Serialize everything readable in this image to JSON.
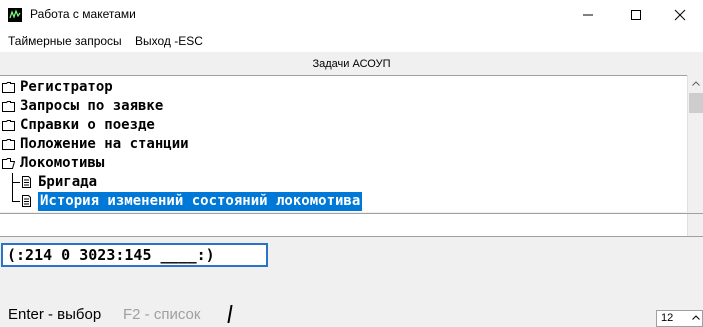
{
  "window": {
    "title": "Работа с макетами"
  },
  "menu": {
    "items": [
      {
        "label": "Таймерные запросы"
      },
      {
        "label": "Выход -ESC"
      }
    ]
  },
  "panel": {
    "header": "Задачи АСОУП"
  },
  "tree": {
    "items": [
      {
        "label": "Регистратор",
        "icon": "folder-icon"
      },
      {
        "label": "Запросы по заявке",
        "icon": "folder-icon"
      },
      {
        "label": "Справки о поезде",
        "icon": "folder-icon"
      },
      {
        "label": "Положение на станции",
        "icon": "folder-icon"
      },
      {
        "label": "Локомотивы",
        "icon": "folder-open-icon"
      },
      {
        "label": "Бригада",
        "icon": "document-icon"
      },
      {
        "label": "История изменений состояний локомотива",
        "icon": "document-icon",
        "selected": true
      }
    ]
  },
  "command": {
    "value": "(:214 0 3023:145 ____:)"
  },
  "status": {
    "enter_hint": "Enter - выбор",
    "f2_hint": "F2 - список",
    "number_value": "12"
  }
}
